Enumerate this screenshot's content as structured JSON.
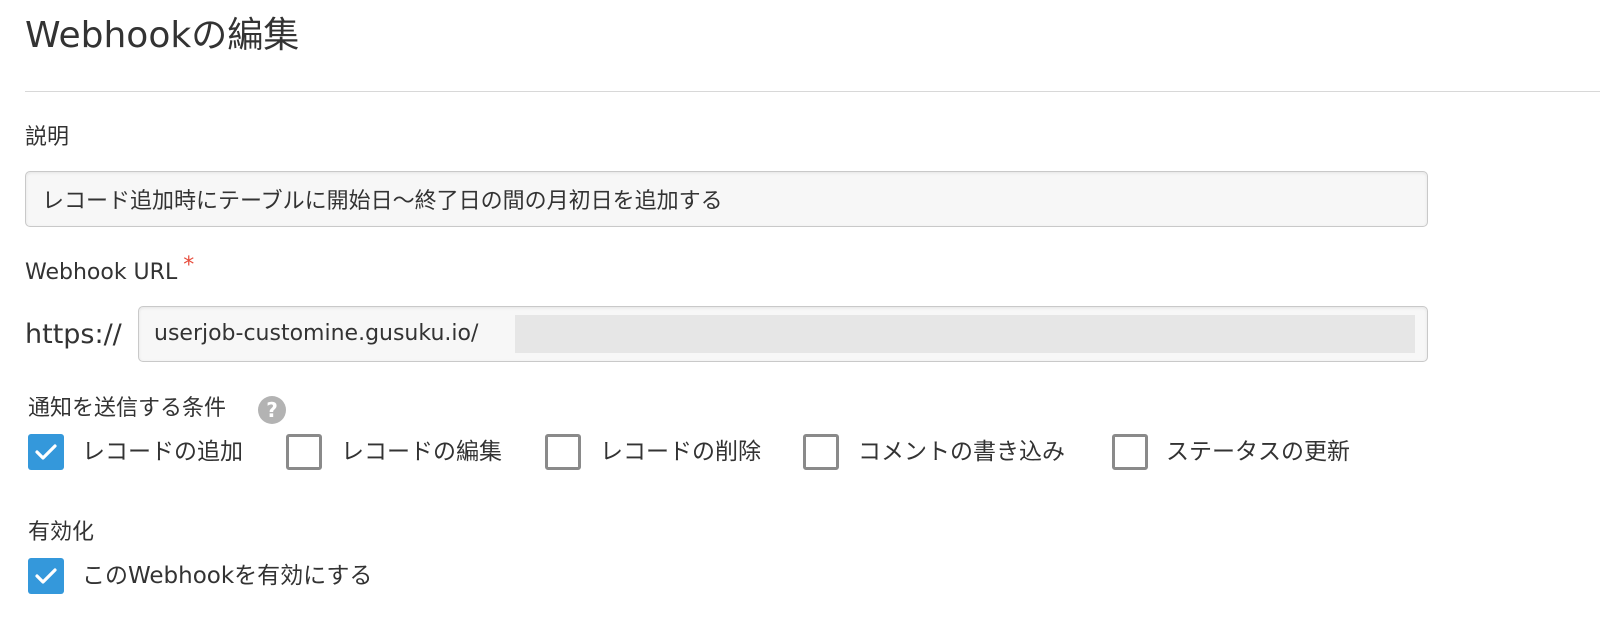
{
  "page": {
    "title": "Webhookの編集"
  },
  "description": {
    "label": "説明",
    "value": "レコード追加時にテーブルに開始日〜終了日の間の月初日を追加する"
  },
  "webhook_url": {
    "label": "Webhook URL",
    "required_mark": "*",
    "prefix": "https://",
    "value": "userjob-customine.gusuku.io/"
  },
  "conditions": {
    "label": "通知を送信する条件",
    "help_icon": "question-circle-icon",
    "options": [
      {
        "label": "レコードの追加",
        "checked": true
      },
      {
        "label": "レコードの編集",
        "checked": false
      },
      {
        "label": "レコードの削除",
        "checked": false
      },
      {
        "label": "コメントの書き込み",
        "checked": false
      },
      {
        "label": "ステータスの更新",
        "checked": false
      }
    ]
  },
  "enable": {
    "label": "有効化",
    "checkbox_label": "このWebhookを有効にする",
    "checked": true
  },
  "colors": {
    "accent": "#3498db",
    "required": "#e74c3c",
    "text": "#333333"
  }
}
